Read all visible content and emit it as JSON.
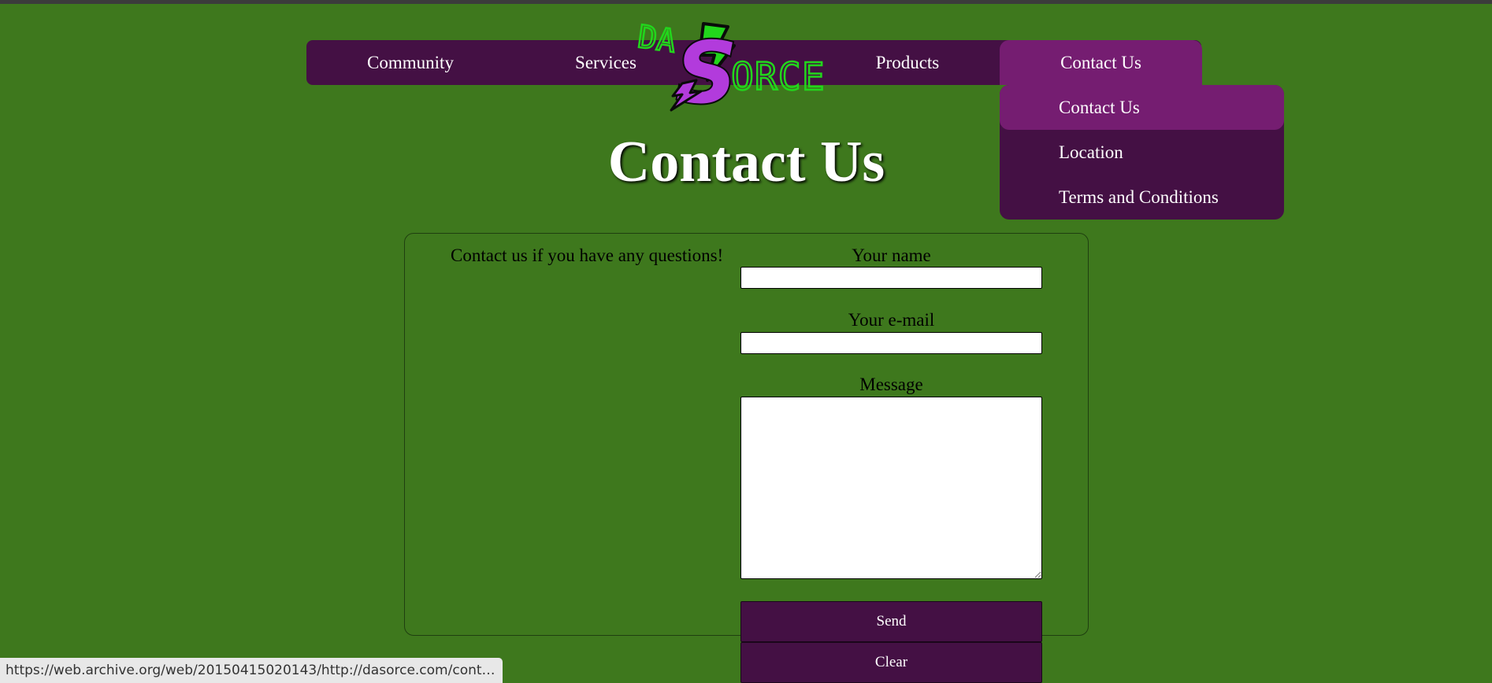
{
  "nav": {
    "items": [
      "Community",
      "Services",
      "Products",
      "Contact Us"
    ],
    "active": "Contact Us"
  },
  "logo": {
    "text_top": "DA",
    "text_big": "S",
    "text_rest": "ORCE",
    "colors": {
      "green": "#22d61c",
      "purple": "#b23bdc",
      "dark": "#0a0a0a"
    }
  },
  "dropdown": {
    "items": [
      "Contact Us",
      "Location",
      "Terms and Conditions"
    ],
    "active": "Contact Us"
  },
  "page": {
    "title": "Contact Us"
  },
  "form": {
    "intro": "Contact us if you have any questions!",
    "name_label": "Your name",
    "name_value": "",
    "email_label": "Your e-mail",
    "email_value": "",
    "message_label": "Message",
    "message_value": "",
    "send_label": "Send",
    "clear_label": "Clear"
  },
  "status_bar": {
    "url": "https://web.archive.org/web/20150415020143/http://dasorce.com/contact.h..."
  },
  "colors": {
    "background": "#3e781d",
    "nav_background": "#441044",
    "nav_active": "#751d71",
    "text_light": "#ffffff"
  }
}
